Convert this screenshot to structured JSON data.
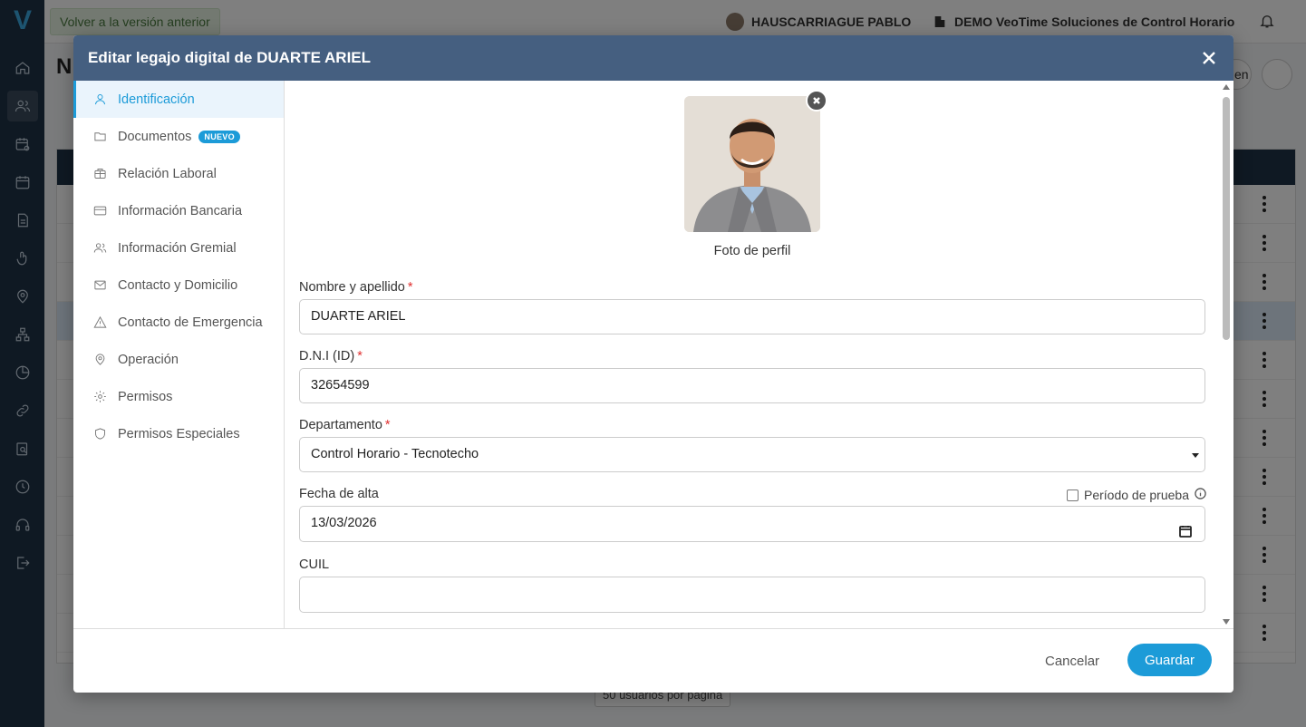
{
  "app": {
    "back_button": "Volver a la versión anterior",
    "user_name": "HAUSCARRIAGUE PABLO",
    "company": "DEMO VeoTime Soluciones de Control Horario",
    "page_title_fragment": "N",
    "pagination": "50 usuarios por página",
    "top_right_fragment": "en"
  },
  "modal": {
    "title": "Editar legajo digital de DUARTE ARIEL",
    "menu": [
      {
        "label": "Identificación",
        "icon": "user-icon",
        "active": true
      },
      {
        "label": "Documentos",
        "icon": "folder-icon",
        "badge": "NUEVO"
      },
      {
        "label": "Relación Laboral",
        "icon": "briefcase-icon"
      },
      {
        "label": "Información Bancaria",
        "icon": "credit-card-icon"
      },
      {
        "label": "Información Gremial",
        "icon": "users-icon"
      },
      {
        "label": "Contacto y Domicilio",
        "icon": "mail-icon"
      },
      {
        "label": "Contacto de Emergencia",
        "icon": "warning-icon"
      },
      {
        "label": "Operación",
        "icon": "map-pin-icon"
      },
      {
        "label": "Permisos",
        "icon": "gear-icon"
      },
      {
        "label": "Permisos Especiales",
        "icon": "shield-icon"
      }
    ],
    "photo_caption": "Foto de perfil",
    "fields": {
      "name": {
        "label": "Nombre y apellido",
        "required": "*",
        "value": "DUARTE ARIEL"
      },
      "dni": {
        "label": "D.N.I (ID)",
        "required": "*",
        "value": "32654599"
      },
      "department": {
        "label": "Departamento",
        "required": "*",
        "value": "Control Horario - Tecnotecho"
      },
      "start_date": {
        "label": "Fecha de alta",
        "value": "13/03/2026"
      },
      "trial_label": "Período de prueba",
      "cuil": {
        "label": "CUIL",
        "value": ""
      }
    },
    "cancel": "Cancelar",
    "save": "Guardar"
  },
  "colors": {
    "header": "#455f80",
    "accent": "#1c9bd8",
    "sidebar": "#1f3247",
    "required": "#e03030"
  }
}
